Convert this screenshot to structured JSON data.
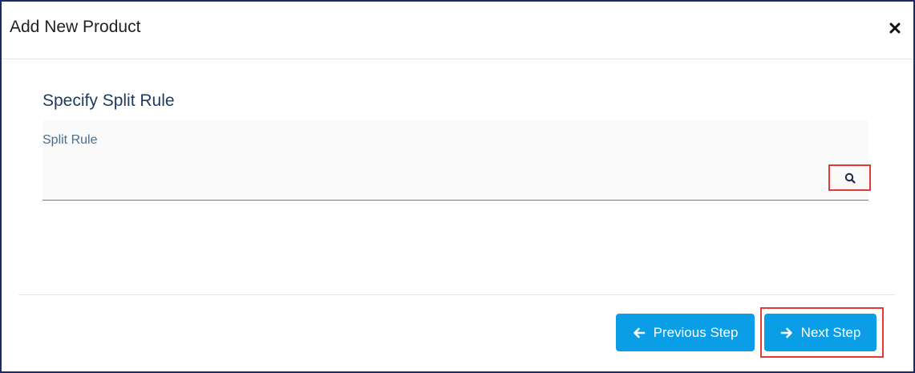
{
  "modal": {
    "title": "Add New Product",
    "close_icon": "close-icon"
  },
  "section": {
    "title": "Specify Split Rule"
  },
  "field": {
    "label": "Split Rule",
    "value": "",
    "placeholder": "",
    "search_icon": "search-icon"
  },
  "footer": {
    "previous_label": "Previous Step",
    "next_label": "Next Step",
    "previous_icon": "arrow-left-icon",
    "next_icon": "arrow-right-icon"
  },
  "colors": {
    "accent": "#0a9ee6",
    "highlight": "#e53935",
    "frame": "#1b2a6b"
  }
}
